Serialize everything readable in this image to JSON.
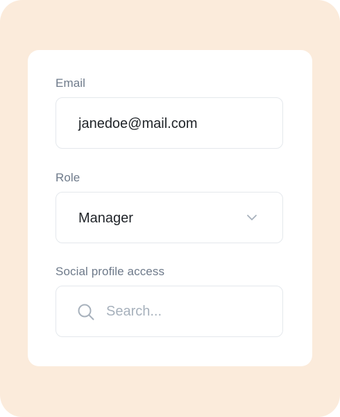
{
  "form": {
    "email": {
      "label": "Email",
      "value": "janedoe@mail.com"
    },
    "role": {
      "label": "Role",
      "selected": "Manager"
    },
    "social_access": {
      "label": "Social profile access",
      "placeholder": "Search..."
    }
  },
  "icons": {
    "role_dropdown": "chevron-down-icon",
    "social_search": "search-icon"
  },
  "colors": {
    "background": "#FBEBDB",
    "card": "#FFFFFF",
    "label_text": "#6E7A8A",
    "value_text": "#1F2328",
    "placeholder_text": "#A7B1BC",
    "field_border": "#E4E8EC"
  }
}
